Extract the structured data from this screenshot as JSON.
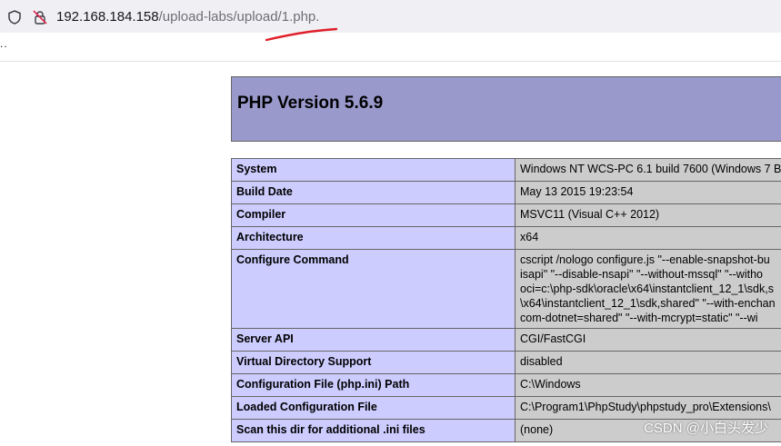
{
  "browser": {
    "url_host": "192.168.184.158",
    "url_path": "/upload-labs/upload/1.php.",
    "page_text": ".."
  },
  "phpinfo": {
    "title": "PHP Version 5.6.9",
    "rows": [
      {
        "key": "System",
        "value": [
          "Windows NT WCS-PC 6.1 build 7600 (Windows 7 B"
        ]
      },
      {
        "key": "Build Date",
        "value": [
          "May 13 2015 19:23:54"
        ]
      },
      {
        "key": "Compiler",
        "value": [
          "MSVC11 (Visual C++ 2012)"
        ]
      },
      {
        "key": "Architecture",
        "value": [
          "x64"
        ]
      },
      {
        "key": "Configure Command",
        "value": [
          "cscript /nologo configure.js \"--enable-snapshot-bu",
          "isapi\" \"--disable-nsapi\" \"--without-mssql\" \"--witho",
          "oci=c:\\php-sdk\\oracle\\x64\\instantclient_12_1\\sdk,s",
          "\\x64\\instantclient_12_1\\sdk,shared\" \"--with-enchan",
          "com-dotnet=shared\" \"--with-mcrypt=static\" \"--wi"
        ]
      },
      {
        "key": "Server API",
        "value": [
          "CGI/FastCGI"
        ]
      },
      {
        "key": "Virtual Directory Support",
        "value": [
          "disabled"
        ]
      },
      {
        "key": "Configuration File (php.ini) Path",
        "value": [
          "C:\\Windows"
        ]
      },
      {
        "key": "Loaded Configuration File",
        "value": [
          "C:\\Program1\\PhpStudy\\phpstudy_pro\\Extensions\\"
        ]
      },
      {
        "key": "Scan this dir for additional .ini files",
        "value": [
          "(none)"
        ]
      }
    ]
  },
  "watermark": "CSDN @小白头发少",
  "colors": {
    "header_bg": "#9999cc",
    "key_bg": "#ccccff",
    "value_bg": "#cccccc",
    "annotation_red": "#e0202a"
  }
}
